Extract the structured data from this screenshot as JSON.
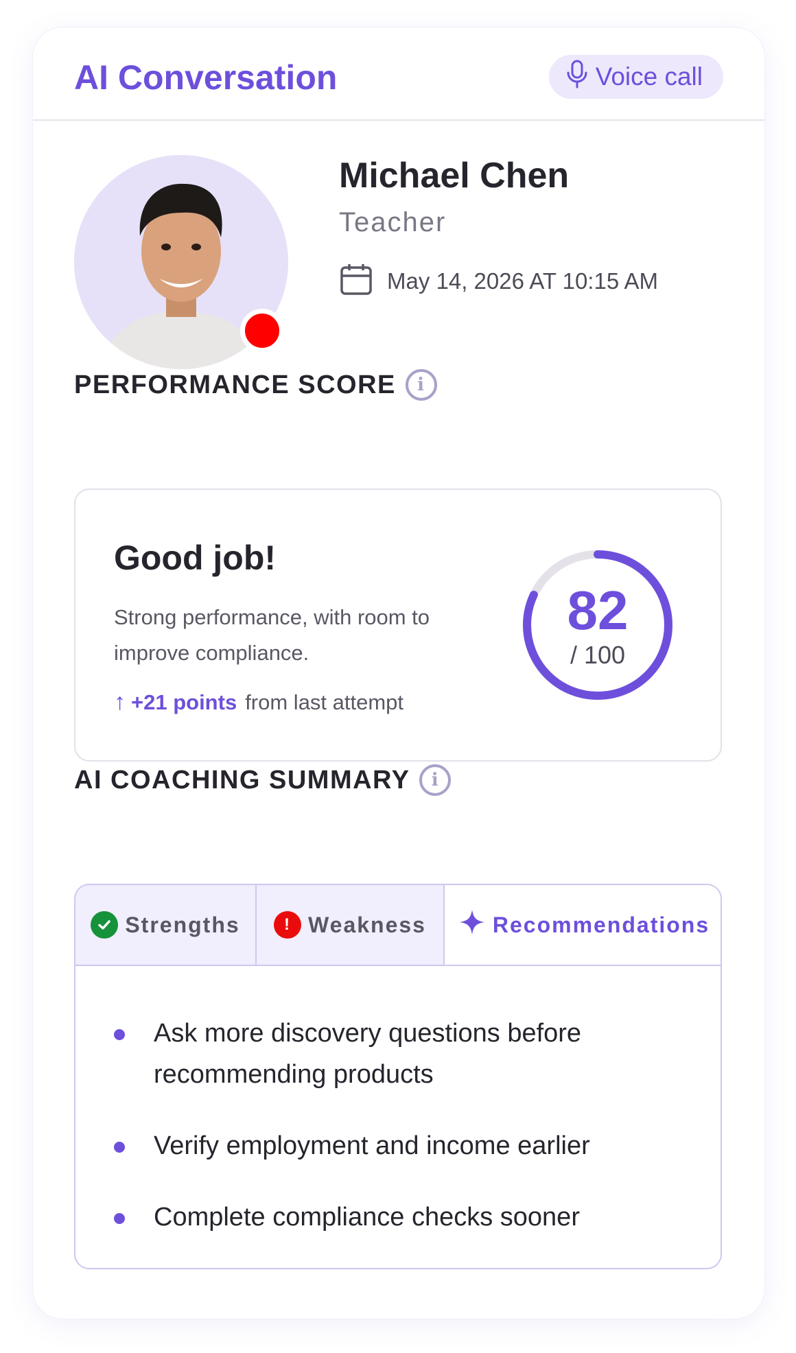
{
  "header": {
    "title": "AI Conversation",
    "voice_call_label": "Voice call"
  },
  "profile": {
    "name": "Michael Chen",
    "role": "Teacher",
    "datetime": "May 14, 2026 AT 10:15 AM",
    "status_color": "#ff0000"
  },
  "performance": {
    "section_title": "PERFORMANCE SCORE",
    "headline": "Good job!",
    "description": "Strong performance, with room to improve compliance.",
    "delta_value": "+21 points",
    "delta_suffix": "from last attempt",
    "score": "82",
    "score_max": "/ 100",
    "score_fraction": 0.82
  },
  "coaching": {
    "section_title": "AI COACHING SUMMARY",
    "tabs": [
      {
        "label": "Strengths",
        "icon": "check-circle-icon",
        "active": false
      },
      {
        "label": "Weakness",
        "icon": "alert-circle-icon",
        "active": false
      },
      {
        "label": "Recommendations",
        "icon": "sparkle-icon",
        "active": true
      }
    ],
    "recommendations": [
      "Ask more discovery questions before recommending products",
      "Verify employment and income earlier",
      "Complete compliance checks sooner"
    ]
  },
  "colors": {
    "accent": "#6d4fdc",
    "success": "#16923a",
    "danger": "#ea0c0c"
  }
}
